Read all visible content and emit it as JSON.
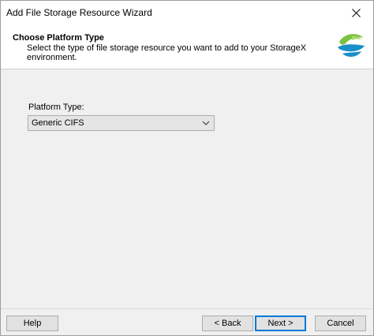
{
  "window": {
    "title": "Add File Storage Resource Wizard"
  },
  "header": {
    "title": "Choose Platform Type",
    "description": "Select the type of file storage resource you want to add to your StorageX environment."
  },
  "form": {
    "platform_type_label": "Platform Type:",
    "platform_type_value": "Generic CIFS"
  },
  "buttons": {
    "help": "Help",
    "back": "< Back",
    "next": "Next >",
    "cancel": "Cancel"
  },
  "icons": {
    "close": "close-icon",
    "logo": "storagex-logo",
    "dropdown": "chevron-down-icon"
  },
  "colors": {
    "accent": "#0078d7",
    "logo_green": "#7cc242",
    "logo_blue": "#1a8fc9"
  }
}
